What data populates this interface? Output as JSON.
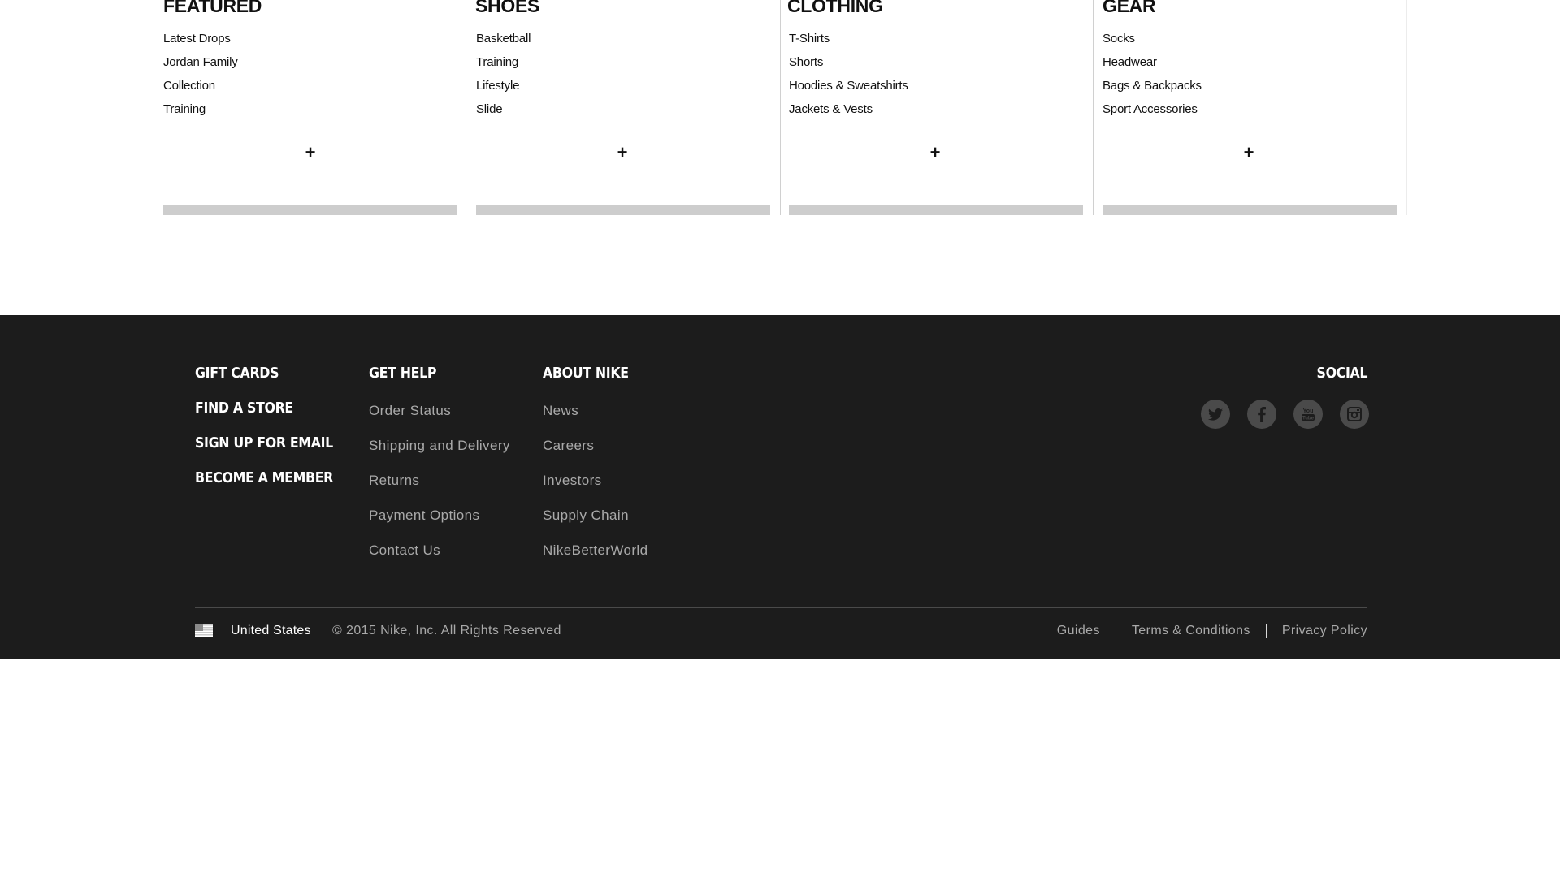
{
  "menu": {
    "columns": [
      {
        "title": "FEATURED",
        "items": [
          "Latest Drops",
          "Jordan Family",
          "Collection",
          "Training"
        ],
        "expand": "+"
      },
      {
        "title": "SHOES",
        "items": [
          "Basketball",
          "Training",
          "Lifestyle",
          "Slide"
        ],
        "expand": "+"
      },
      {
        "title": "CLOTHING",
        "items": [
          "T-Shirts",
          "Shorts",
          "Hoodies & Sweatshirts",
          "Jackets & Vests"
        ],
        "expand": "+"
      },
      {
        "title": "GEAR",
        "items": [
          "Socks",
          "Headwear",
          "Bags & Backpacks",
          "Sport Accessories"
        ],
        "expand": "+"
      }
    ]
  },
  "footer": {
    "primary_links": [
      "GIFT CARDS",
      "FIND A STORE",
      "SIGN UP FOR EMAIL",
      "BECOME A MEMBER"
    ],
    "get_help": {
      "title": "GET HELP",
      "items": [
        "Order Status",
        "Shipping and Delivery",
        "Returns",
        "Payment Options",
        "Contact Us"
      ]
    },
    "about": {
      "title": "ABOUT NIKE",
      "items": [
        "News",
        "Careers",
        "Investors",
        "Supply Chain",
        "NikeBetterWorld"
      ]
    },
    "social": {
      "title": "SOCIAL",
      "icons": [
        "twitter-icon",
        "facebook-icon",
        "youtube-icon",
        "instagram-icon"
      ]
    },
    "country": "United States",
    "copyright": "© 2015 Nike, Inc. All Rights Reserved",
    "legal_links": [
      "Guides",
      "Terms & Conditions",
      "Privacy Policy"
    ]
  },
  "colors": {
    "footer_bg": "#1c1c1c",
    "footer_text_muted": "#a9a9a9",
    "menu_bar": "#cdcdcd",
    "social_icon_bg": "#4a4a4a"
  }
}
